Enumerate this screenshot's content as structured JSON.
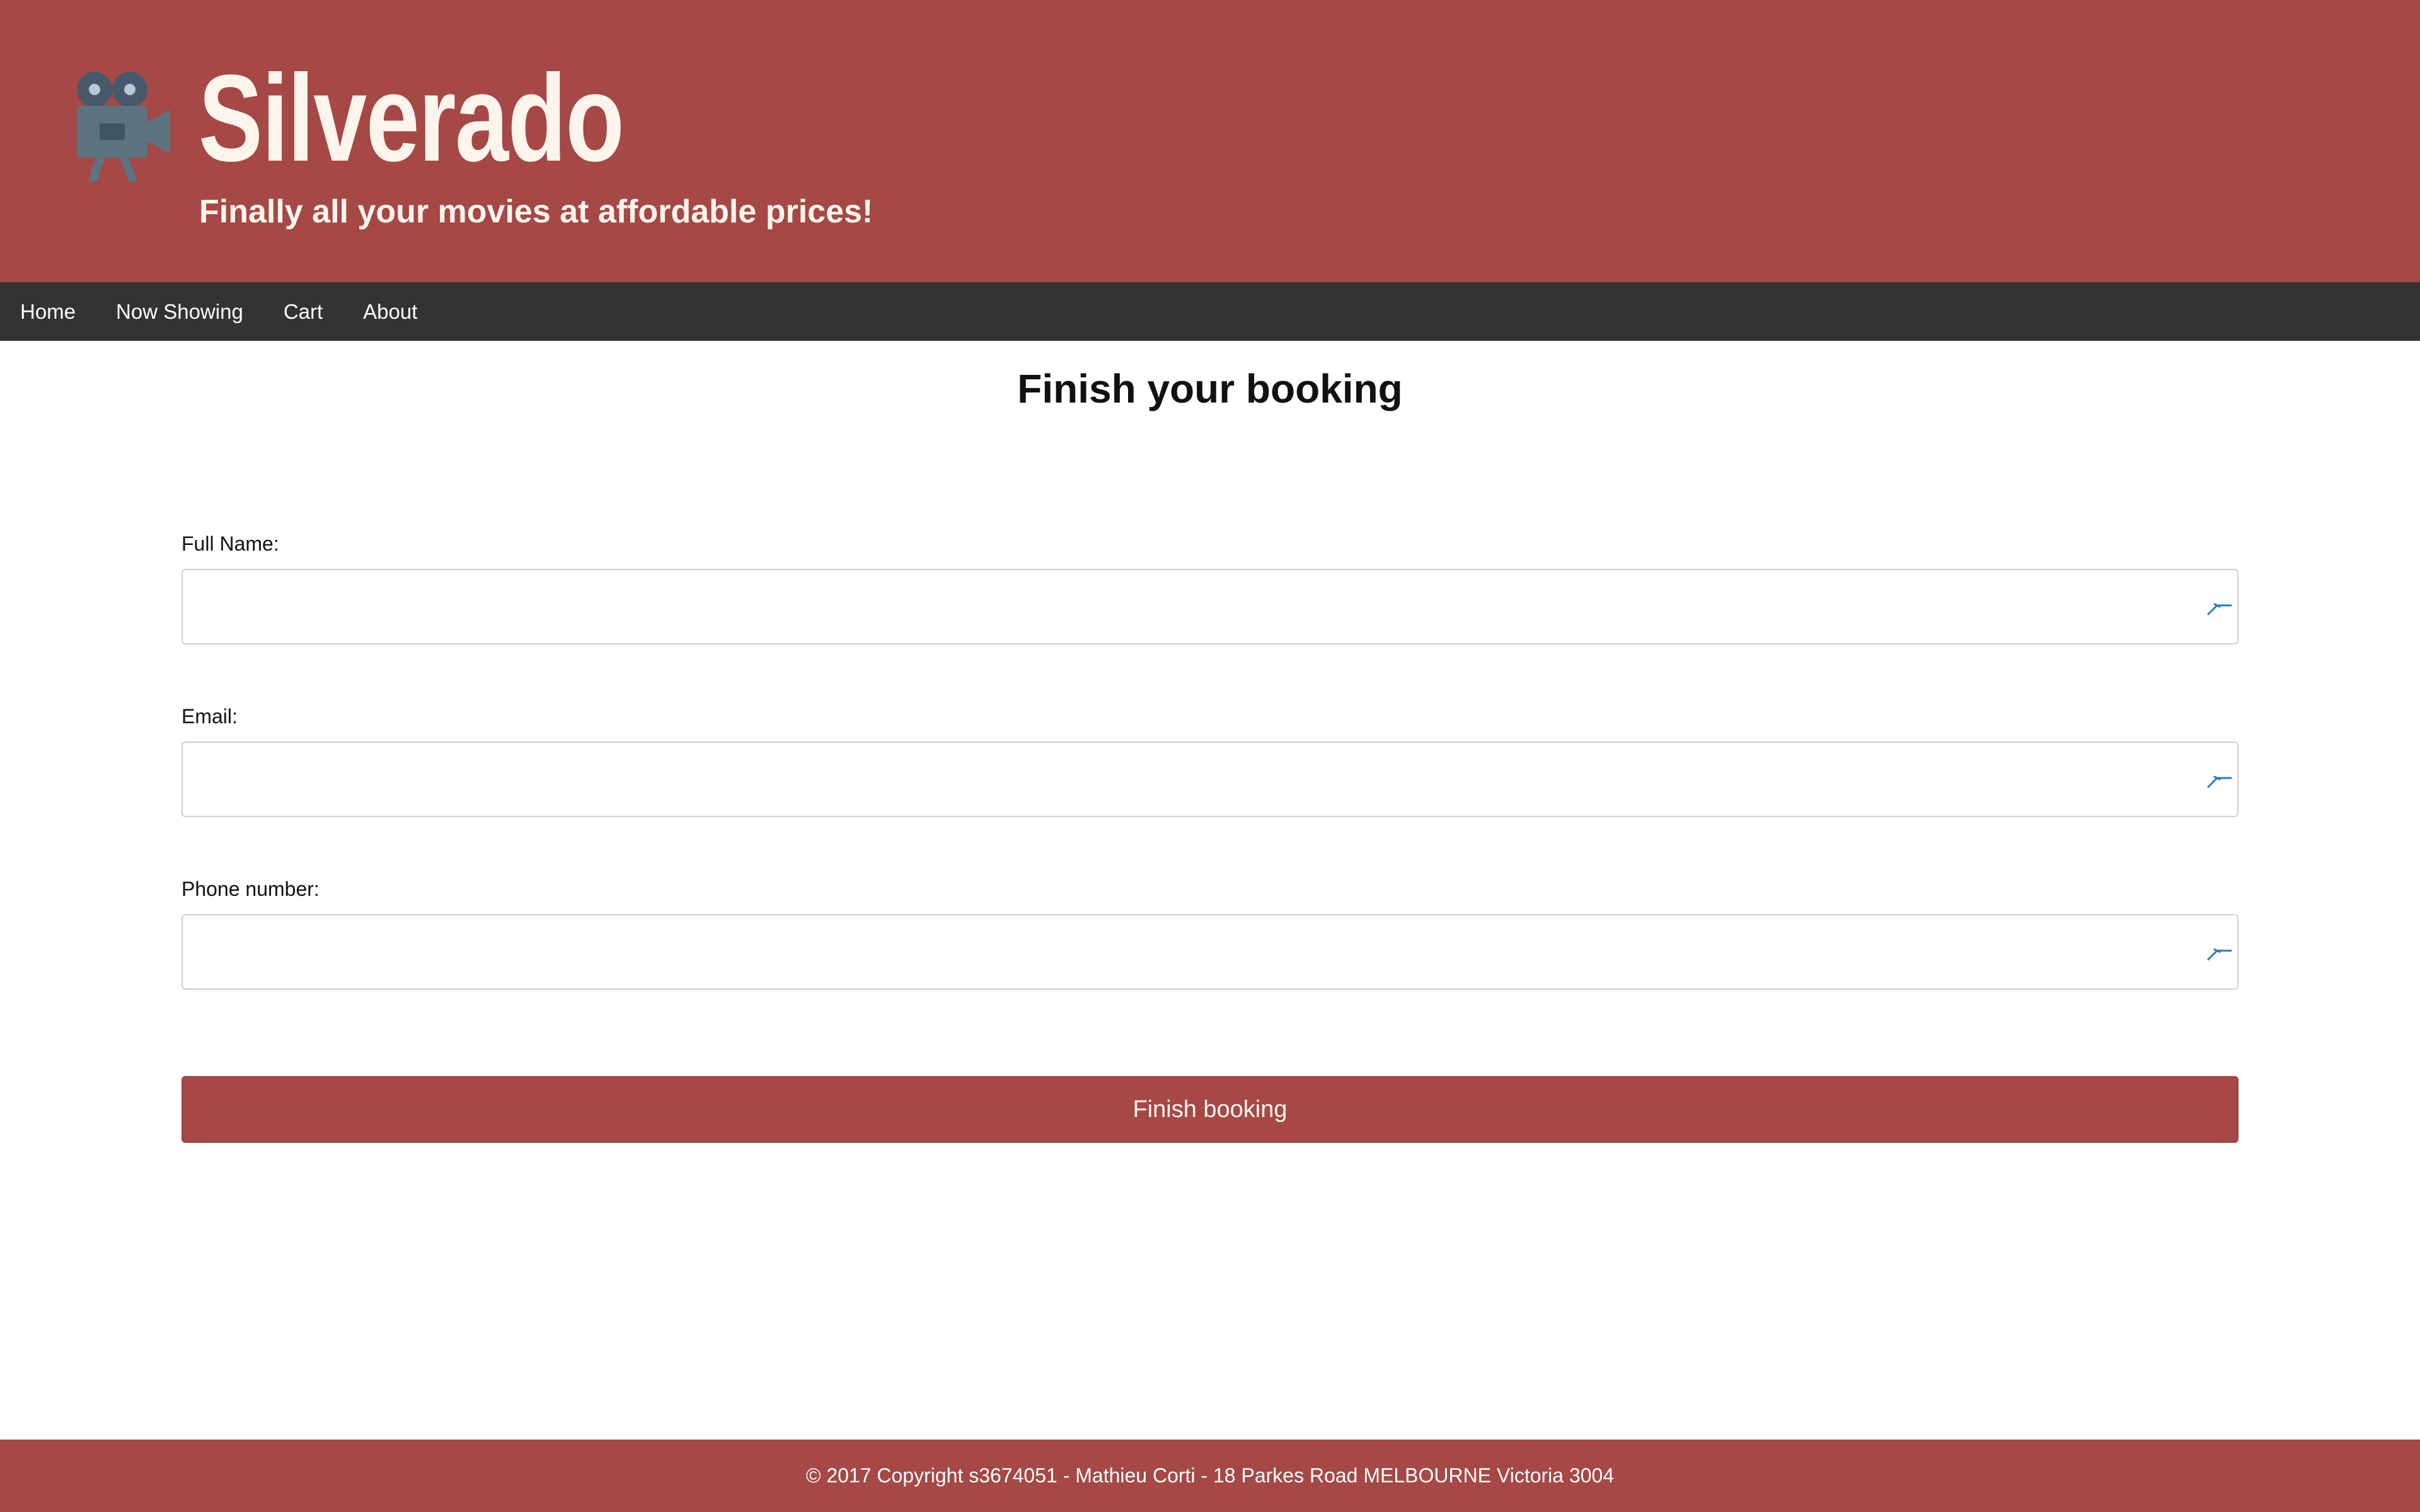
{
  "header": {
    "logo_icon": "movie-camera-icon",
    "title": "Silverado",
    "tagline": "Finally all your movies at affordable prices!"
  },
  "nav": {
    "items": [
      {
        "label": "Home"
      },
      {
        "label": "Now Showing"
      },
      {
        "label": "Cart"
      },
      {
        "label": "About"
      }
    ]
  },
  "main": {
    "heading": "Finish your booking",
    "form": {
      "fields": [
        {
          "label": "Full Name:",
          "value": "",
          "icon": "autofill-key-icon"
        },
        {
          "label": "Email:",
          "value": "",
          "icon": "autofill-key-icon"
        },
        {
          "label": "Phone number:",
          "value": "",
          "icon": "autofill-key-icon"
        }
      ],
      "submit_label": "Finish booking"
    }
  },
  "footer": {
    "text": "© 2017 Copyright s3674051 - Mathieu Corti - 18 Parkes Road MELBOURNE Victoria 3004"
  },
  "colors": {
    "brand": "#a54846",
    "nav_bg": "#333333",
    "header_text": "#fdf5ec",
    "icon_blue": "#2a7ab8"
  }
}
